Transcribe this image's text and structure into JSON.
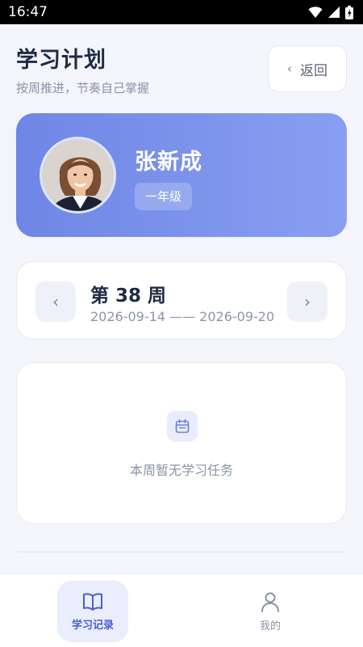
{
  "status_bar": {
    "time": "16:47"
  },
  "header": {
    "title": "学习计划",
    "subtitle": "按周推进，节奏自己掌握",
    "back_label": "返回"
  },
  "profile": {
    "name": "张新成",
    "grade": "一年级"
  },
  "week": {
    "title": "第 38 周",
    "range": "2026-09-14 —— 2026-09-20"
  },
  "empty_state": {
    "message": "本周暂无学习任务"
  },
  "bottom_nav": {
    "items": [
      {
        "label": "学习记录",
        "icon": "book-icon",
        "active": true
      },
      {
        "label": "我的",
        "icon": "person-icon",
        "active": false
      }
    ]
  },
  "colors": {
    "accent": "#4a5fd0",
    "card_gradient_start": "#6f86e6",
    "card_gradient_end": "#889ff0",
    "background": "#f3f5fa"
  }
}
